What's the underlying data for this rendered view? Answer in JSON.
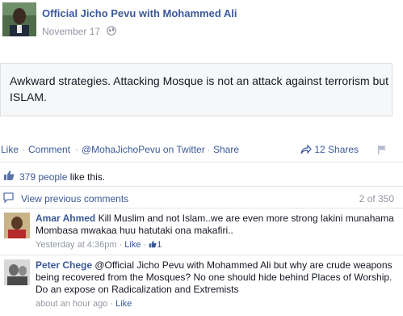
{
  "post": {
    "page_name": "Official Jicho Pevu with Mohammed Ali",
    "date": "November 17",
    "text": "Awkward strategies. Attacking Mosque is not an attack against terrorism but ISLAM."
  },
  "actions": {
    "like": "Like",
    "comment": "Comment",
    "mention": "@MohaJichoPevu on Twitter",
    "share": "Share",
    "shares_count": "12 Shares",
    "separator": "·"
  },
  "likes": {
    "count_link": "379 people",
    "suffix": " like this."
  },
  "comments_header": {
    "view_previous": "View previous comments",
    "count": "2 of 350"
  },
  "comments": [
    {
      "author": "Amar Ahmed",
      "text": "Kill Muslim and not Islam..we are even more strong lakini munahama Mombasa mwakaa huu hatutaki ona makafiri..",
      "time": "Yesterday at 4:36pm",
      "like_label": "Like",
      "like_count": "1",
      "separator": "·"
    },
    {
      "author": "Peter Chege",
      "text": "@Official Jicho Pevu with Mohammed Ali but why are crude weapons being recovered from the Mosques? No one should hide behind Places of Worship. Do an expose on Radicalization and Extremists",
      "time": "about an hour ago",
      "like_label": "Like",
      "separator": "·"
    }
  ],
  "icons": {
    "globe": "globe-icon",
    "share_arrow": "share-arrow-icon",
    "flag": "flag-icon",
    "thumb": "thumbs-up-icon",
    "bubble": "comment-bubble-icon"
  },
  "colors": {
    "link": "#3b5998",
    "meta": "#9197a3",
    "text": "#141823"
  }
}
